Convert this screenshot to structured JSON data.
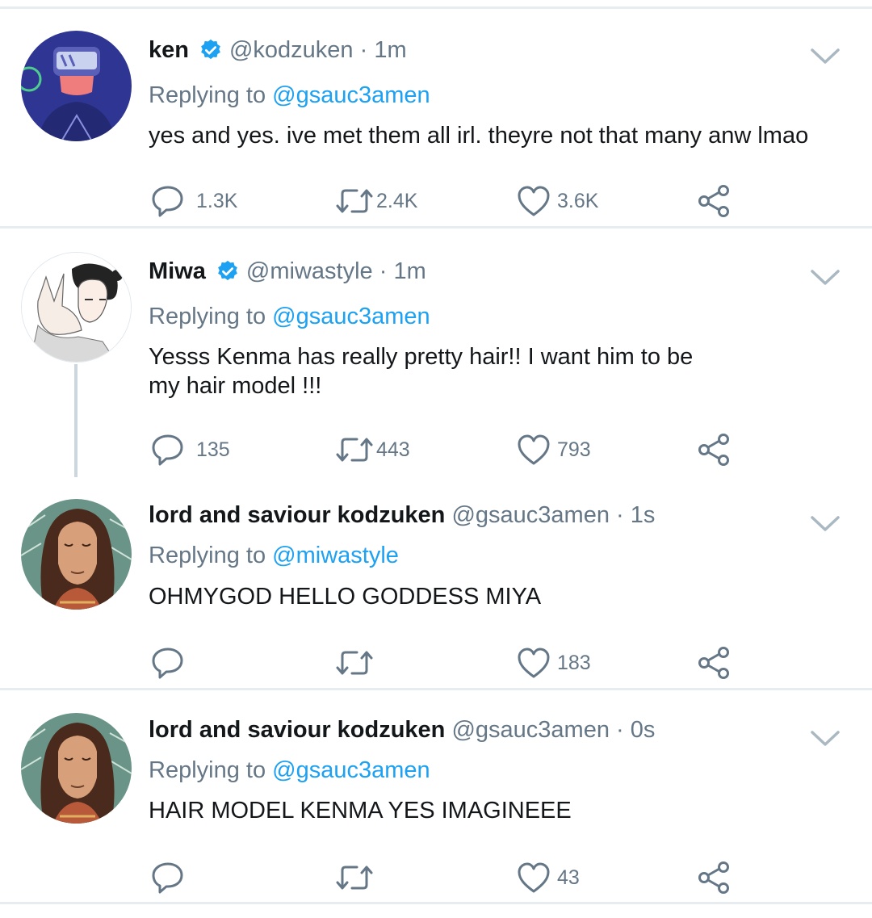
{
  "tweets": [
    {
      "name": "ken",
      "verified": true,
      "handle": "@kodzuken",
      "dot": " · ",
      "time": "1m",
      "replying_prefix": "Replying to ",
      "replying_to": "@gsauc3amen",
      "text": "yes and yes. ive met them all irl. theyre not that many anw lmao",
      "replies": "1.3K",
      "retweets": "2.4K",
      "likes": "3.6K"
    },
    {
      "name": "Miwa",
      "verified": true,
      "handle": "@miwastyle",
      "dot": " · ",
      "time": "1m",
      "replying_prefix": "Replying to ",
      "replying_to": "@gsauc3amen",
      "text_line1": "Yesss Kenma has really pretty hair!! I want him to be",
      "text_line2": "my hair model !!!",
      "replies": "135",
      "retweets": "443",
      "likes": "793"
    },
    {
      "name": "lord and saviour kodzuken",
      "verified": false,
      "handle": "@gsauc3amen",
      "dot": " · ",
      "time": "1s",
      "replying_prefix": "Replying to ",
      "replying_to": "@miwastyle",
      "text": "OHMYGOD HELLO GODDESS MIYA",
      "replies": "",
      "retweets": "",
      "likes": "183"
    },
    {
      "name": "lord and saviour kodzuken",
      "verified": false,
      "handle": "@gsauc3amen",
      "dot": " · ",
      "time": "0s",
      "replying_prefix": "Replying to ",
      "replying_to": "@gsauc3amen",
      "text": "HAIR MODEL KENMA YES IMAGINEEE",
      "replies": "",
      "retweets": "",
      "likes": "43"
    }
  ],
  "colors": {
    "text": "#14171a",
    "secondary": "#657786",
    "link": "#1da1f2",
    "verified": "#1da1f2",
    "divider": "#e6ecf0"
  },
  "icons": [
    "reply-icon",
    "retweet-icon",
    "like-icon",
    "share-icon",
    "chevron-down-icon",
    "verified-badge-icon"
  ]
}
